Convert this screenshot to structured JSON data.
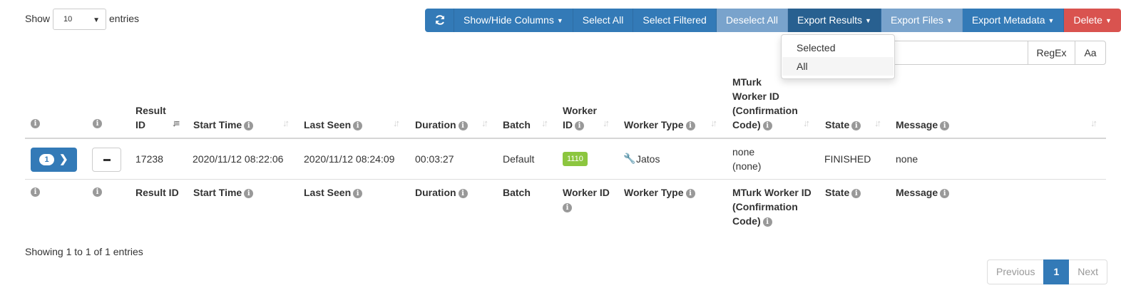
{
  "length": {
    "label_pre": "Show",
    "value": "10",
    "label_post": "entries"
  },
  "toolbar": {
    "refresh_icon": "refresh-icon",
    "buttons": [
      "Show/Hide Columns",
      "Select All",
      "Select Filtered",
      "Deselect All",
      "Export Results",
      "Export Files",
      "Export Metadata",
      "Delete"
    ]
  },
  "export_menu": {
    "items": [
      "Selected",
      "All"
    ]
  },
  "search": {
    "value": "",
    "regex_label": "RegEx",
    "case_label": "Aa"
  },
  "header": {
    "result_id": [
      "Result",
      "ID"
    ],
    "start_time": "Start Time",
    "last_seen": "Last Seen",
    "duration": "Duration",
    "batch": "Batch",
    "worker_id": [
      "Worker",
      "ID"
    ],
    "worker_type": "Worker Type",
    "mturk": [
      "MTurk",
      "Worker ID",
      "(Confirmation",
      "Code)"
    ],
    "state": "State",
    "message": "Message"
  },
  "row": {
    "badge": "1",
    "result_id": "17238",
    "start_time": "2020/11/12 08:22:06",
    "last_seen": "2020/11/12 08:24:09",
    "duration": "00:03:27",
    "batch": "Default",
    "worker_id": "1110",
    "worker_type": "Jatos",
    "mturk": [
      "none",
      "(none)"
    ],
    "state": "FINISHED",
    "message": "none"
  },
  "footer": {
    "result_id": "Result ID",
    "start_time": "Start Time",
    "last_seen": "Last Seen",
    "duration": "Duration",
    "batch": "Batch",
    "worker_id": "Worker ID",
    "worker_type": "Worker Type",
    "mturk": [
      "MTurk Worker ID",
      "(Confirmation",
      "Code)"
    ],
    "state": "State",
    "message": "Message"
  },
  "info_text": "Showing 1 to 1 of 1 entries",
  "pagination": {
    "previous": "Previous",
    "current": "1",
    "next": "Next"
  },
  "colors": {
    "primary": "#337ab7",
    "danger": "#d9534f",
    "success_badge": "#8cc63f",
    "disabled_button": "#79a3cc"
  }
}
